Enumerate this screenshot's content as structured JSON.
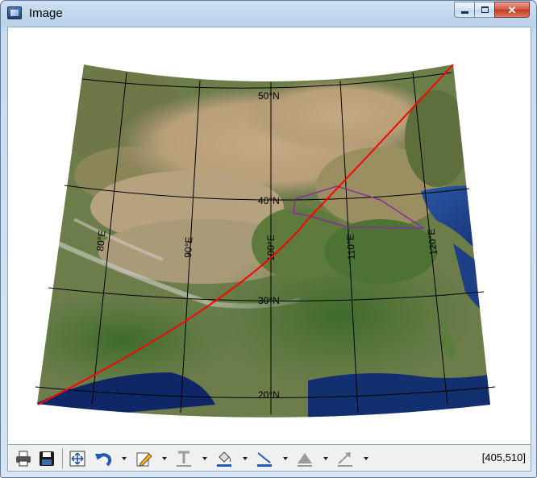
{
  "window": {
    "title": "Image"
  },
  "titlebar": {
    "minimize_glyph": "—",
    "maximize_glyph": "□",
    "close_glyph": "✕"
  },
  "map": {
    "projection": "conic",
    "meridian_labels": [
      "80°E",
      "90°E",
      "100°E",
      "110°E",
      "120°E"
    ],
    "parallel_labels": [
      "50°N",
      "40°N",
      "30°N",
      "20°N"
    ],
    "graticule_color": "#000000",
    "great_circle_color": "#ff0000",
    "polygon_color": "#8b2a9c"
  },
  "toolbar": {
    "icons": [
      "print-icon",
      "save-icon",
      "fit-icon",
      "undo-icon",
      "pencil-icon",
      "text-icon",
      "fill-icon",
      "line-icon",
      "shape-icon",
      "arrow-icon"
    ],
    "cursor_position": "[405,510]"
  }
}
